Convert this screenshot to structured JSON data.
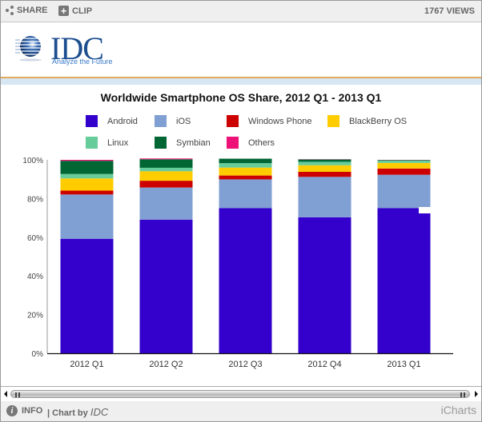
{
  "toolbar": {
    "share_label": "SHARE",
    "clip_label": "CLIP",
    "views_label": "1767 VIEWS"
  },
  "logo": {
    "name": "IDC",
    "tagline": "Analyze the Future"
  },
  "footer": {
    "info_label": "INFO",
    "chart_by_prefix": "| Chart by",
    "chart_by_name": "IDC",
    "brand": "iCharts"
  },
  "colors": {
    "Android": "#3300cc",
    "iOS": "#809fd3",
    "Windows Phone": "#cc0000",
    "BlackBerry OS": "#ffcc00",
    "Linux": "#66cc99",
    "Symbian": "#006633",
    "Others": "#ee1177"
  },
  "chart_data": {
    "type": "bar",
    "stacked": true,
    "title": "Worldwide Smartphone OS Share, 2012 Q1 - 2013 Q1",
    "xlabel": "",
    "ylabel": "",
    "ylim": [
      0,
      100
    ],
    "yticks": [
      "0%",
      "20%",
      "40%",
      "60%",
      "80%",
      "100%"
    ],
    "ytick_values": [
      0,
      20,
      40,
      60,
      80,
      100
    ],
    "grid": false,
    "legend_position": "top",
    "categories": [
      "2012 Q1",
      "2012 Q2",
      "2012 Q3",
      "2012 Q4",
      "2013 Q1"
    ],
    "series": [
      {
        "name": "Android",
        "values": [
          59.2,
          69.1,
          75.0,
          70.3,
          75.0
        ]
      },
      {
        "name": "iOS",
        "values": [
          22.9,
          16.6,
          14.9,
          20.9,
          17.3
        ]
      },
      {
        "name": "Windows Phone",
        "values": [
          2.0,
          3.5,
          2.0,
          2.6,
          3.2
        ]
      },
      {
        "name": "BlackBerry OS",
        "values": [
          6.3,
          4.9,
          4.1,
          3.4,
          2.9
        ]
      },
      {
        "name": "Linux",
        "values": [
          2.3,
          1.8,
          2.3,
          1.8,
          1.2
        ]
      },
      {
        "name": "Symbian",
        "values": [
          6.8,
          4.4,
          2.3,
          1.2,
          0.3
        ]
      },
      {
        "name": "Others",
        "values": [
          0.5,
          0.4,
          0.0,
          0.1,
          0.1
        ]
      }
    ]
  }
}
